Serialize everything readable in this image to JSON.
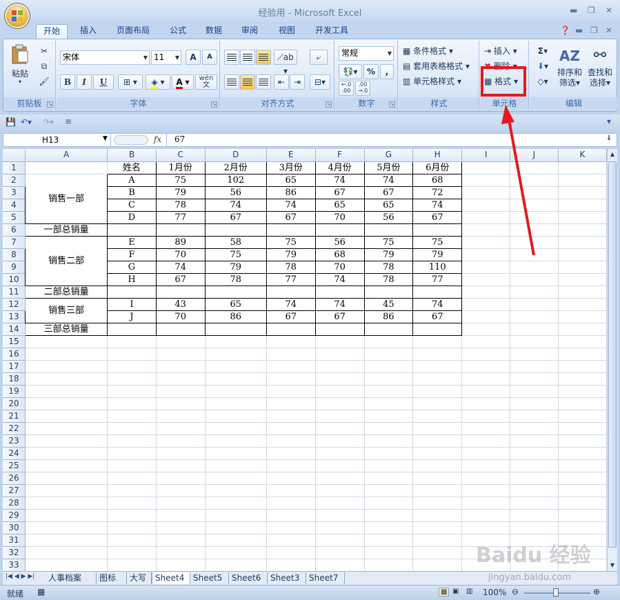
{
  "window": {
    "title": "经验用 - Microsoft Excel"
  },
  "tabs": [
    "开始",
    "插入",
    "页面布局",
    "公式",
    "数据",
    "审阅",
    "视图",
    "开发工具"
  ],
  "ribbon": {
    "clipboard": {
      "label": "剪贴板",
      "paste": "粘贴"
    },
    "font": {
      "label": "字体",
      "font_name": "宋体",
      "font_size": "11",
      "bold": "B",
      "italic": "I",
      "underline": "U",
      "grow": "A",
      "shrink": "A",
      "phonetic": "wén"
    },
    "alignment": {
      "label": "对齐方式"
    },
    "number": {
      "label": "数字",
      "format": "常规",
      "percent": "%",
      "comma": ",",
      "inc_dec": "←.0 .00",
      "dec_dec": ".00 →.0"
    },
    "styles": {
      "label": "样式",
      "conditional": "条件格式",
      "table": "套用表格格式",
      "cell_styles": "单元格样式"
    },
    "cells": {
      "label": "单元格",
      "insert": "插入",
      "delete": "删除",
      "format": "格式"
    },
    "editing": {
      "label": "编辑",
      "sum": "Σ",
      "sort_filter_1": "排序和",
      "sort_filter_2": "筛选",
      "find_select_1": "查找和",
      "find_select_2": "选择"
    }
  },
  "formula_bar": {
    "name_box": "H13",
    "fx": "fx",
    "value": "67"
  },
  "columns": [
    "A",
    "B",
    "C",
    "D",
    "E",
    "F",
    "G",
    "H",
    "I",
    "J",
    "K"
  ],
  "rows": [
    "1",
    "2",
    "3",
    "4",
    "5",
    "6",
    "7",
    "8",
    "9",
    "10",
    "11",
    "12",
    "13",
    "14",
    "15",
    "16",
    "17",
    "18",
    "19",
    "20",
    "21",
    "22",
    "23",
    "24",
    "25",
    "26",
    "27",
    "28",
    "29",
    "30",
    "31",
    "32",
    "33"
  ],
  "table": {
    "header": [
      "姓名",
      "1月份",
      "2月份",
      "3月份",
      "4月份",
      "5月份",
      "6月份"
    ],
    "dept1": "销售一部",
    "dept2": "销售二部",
    "dept3": "销售三部",
    "total1": "一部总销量",
    "total2": "二部总销量",
    "total3": "三部总销量",
    "data": [
      [
        "A",
        "75",
        "102",
        "65",
        "74",
        "74",
        "68"
      ],
      [
        "B",
        "79",
        "56",
        "86",
        "67",
        "67",
        "72"
      ],
      [
        "C",
        "78",
        "74",
        "74",
        "65",
        "65",
        "74"
      ],
      [
        "D",
        "77",
        "67",
        "67",
        "70",
        "56",
        "67"
      ],
      [
        "E",
        "89",
        "58",
        "75",
        "56",
        "75",
        "75"
      ],
      [
        "F",
        "70",
        "75",
        "79",
        "68",
        "79",
        "79"
      ],
      [
        "G",
        "74",
        "79",
        "78",
        "70",
        "78",
        "110"
      ],
      [
        "H",
        "67",
        "78",
        "77",
        "74",
        "78",
        "77"
      ],
      [
        "I",
        "43",
        "65",
        "74",
        "74",
        "45",
        "74"
      ],
      [
        "J",
        "70",
        "86",
        "67",
        "67",
        "86",
        "67"
      ]
    ]
  },
  "sheets": [
    "人事档案",
    "图标",
    "大写",
    "Sheet4",
    "Sheet5",
    "Sheet6",
    "Sheet3",
    "Sheet7"
  ],
  "active_sheet": "Sheet4",
  "status": {
    "ready": "就绪",
    "zoom": "100%"
  },
  "watermark": {
    "brand": "Baidu 经验",
    "url": "jingyan.baidu.com"
  },
  "colors": {
    "highlight": "#e5191f",
    "accent": "#15428b"
  }
}
